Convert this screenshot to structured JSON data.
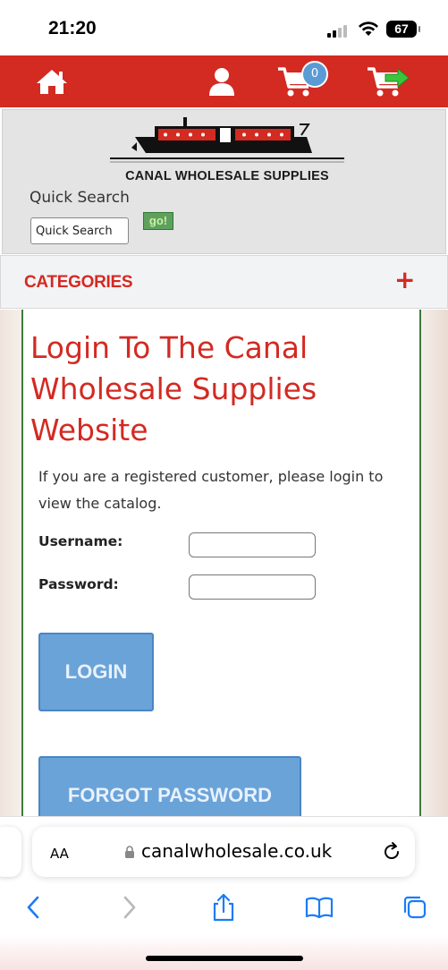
{
  "status_bar": {
    "time": "21:20",
    "battery": "67"
  },
  "nav": {
    "cart_count": "0"
  },
  "header": {
    "logo_text": "CANAL WHOLESALE SUPPLIES",
    "quick_search_label": "Quick Search",
    "quick_search_placeholder": "Quick Search",
    "go_label": "go!"
  },
  "categories": {
    "label": "CATEGORIES",
    "toggle": "+"
  },
  "main": {
    "title": "Login To The Canal Wholesale Supplies Website",
    "intro": "If you are a registered customer, please login to view the catalog.",
    "username_label": "Username:",
    "username_value": "",
    "password_label": "Password:",
    "password_value": "",
    "login_button": "LOGIN",
    "forgot_button": "FORGOT PASSWORD"
  },
  "browser": {
    "aa_label": "AA",
    "url": "canalwholesale.co.uk"
  },
  "colors": {
    "brand_red": "#d32a22",
    "button_blue": "#6aa3d8",
    "go_green": "#5fa05f",
    "panel_border": "#3f7a3f"
  },
  "icons": [
    "home-icon",
    "user-icon",
    "cart-icon",
    "checkout-cart-icon",
    "lock-icon",
    "reload-icon",
    "back-icon",
    "forward-icon",
    "share-icon",
    "bookmarks-icon",
    "tabs-icon"
  ]
}
